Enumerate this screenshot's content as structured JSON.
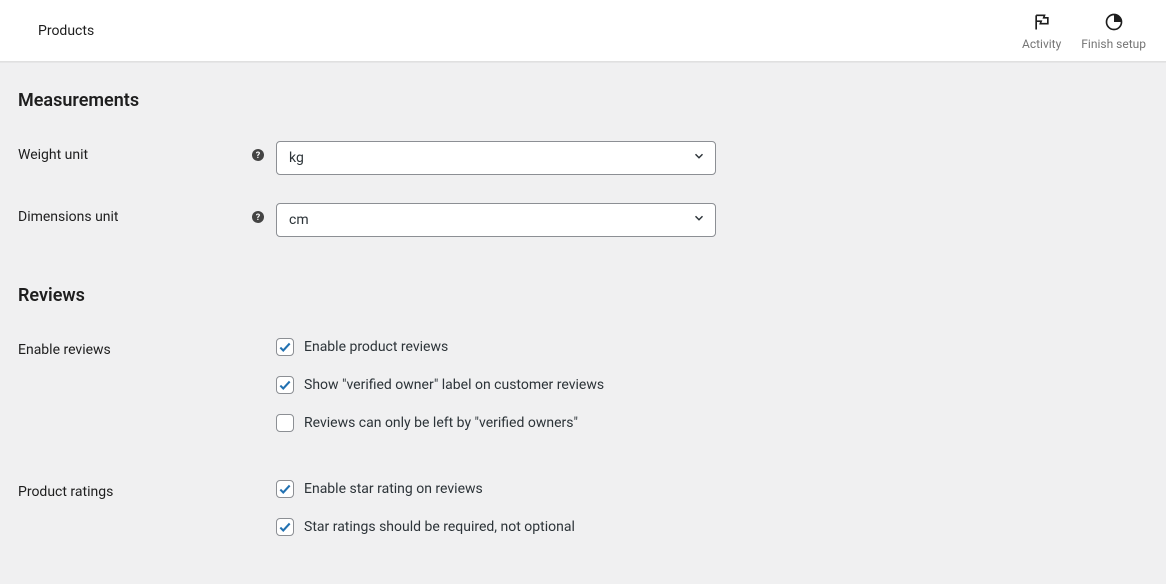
{
  "header": {
    "title": "Products",
    "activity_label": "Activity",
    "finish_setup_label": "Finish setup"
  },
  "sections": {
    "measurements": {
      "heading": "Measurements",
      "weight_unit": {
        "label": "Weight unit",
        "value": "kg"
      },
      "dimensions_unit": {
        "label": "Dimensions unit",
        "value": "cm"
      }
    },
    "reviews": {
      "heading": "Reviews",
      "enable_reviews": {
        "label": "Enable reviews",
        "options": [
          {
            "label": "Enable product reviews",
            "checked": true
          },
          {
            "label": "Show \"verified owner\" label on customer reviews",
            "checked": true
          },
          {
            "label": "Reviews can only be left by \"verified owners\"",
            "checked": false
          }
        ]
      },
      "product_ratings": {
        "label": "Product ratings",
        "options": [
          {
            "label": "Enable star rating on reviews",
            "checked": true
          },
          {
            "label": "Star ratings should be required, not optional",
            "checked": true
          }
        ]
      }
    }
  }
}
